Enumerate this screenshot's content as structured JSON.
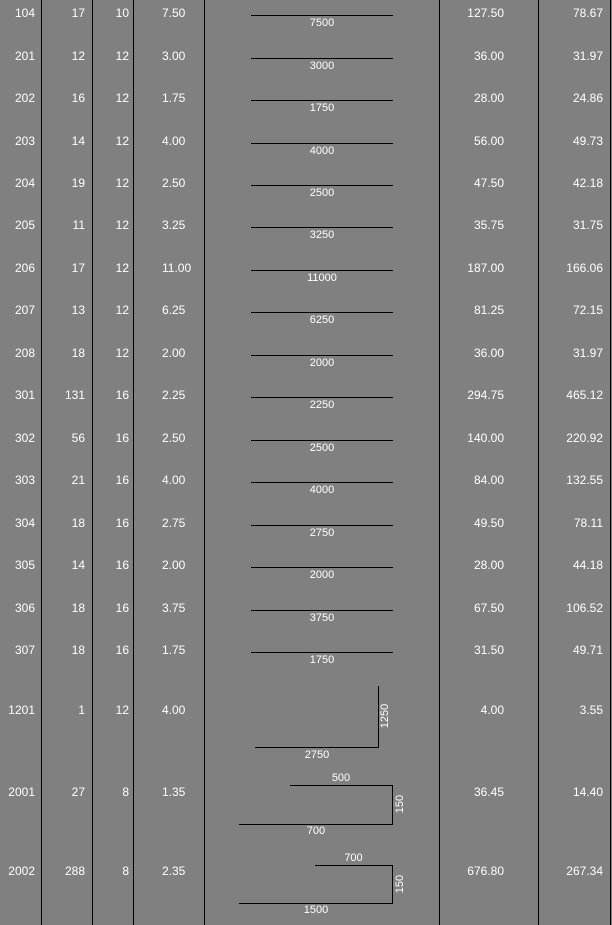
{
  "rows": [
    {
      "mark": "104",
      "count": "17",
      "dia": "10",
      "length": "7.50",
      "shape": "straight",
      "dims": [
        "7500"
      ],
      "total": "127.50",
      "weight": "78.67"
    },
    {
      "mark": "201",
      "count": "12",
      "dia": "12",
      "length": "3.00",
      "shape": "straight",
      "dims": [
        "3000"
      ],
      "total": "36.00",
      "weight": "31.97"
    },
    {
      "mark": "202",
      "count": "16",
      "dia": "12",
      "length": "1.75",
      "shape": "straight",
      "dims": [
        "1750"
      ],
      "total": "28.00",
      "weight": "24.86"
    },
    {
      "mark": "203",
      "count": "14",
      "dia": "12",
      "length": "4.00",
      "shape": "straight",
      "dims": [
        "4000"
      ],
      "total": "56.00",
      "weight": "49.73"
    },
    {
      "mark": "204",
      "count": "19",
      "dia": "12",
      "length": "2.50",
      "shape": "straight",
      "dims": [
        "2500"
      ],
      "total": "47.50",
      "weight": "42.18"
    },
    {
      "mark": "205",
      "count": "11",
      "dia": "12",
      "length": "3.25",
      "shape": "straight",
      "dims": [
        "3250"
      ],
      "total": "35.75",
      "weight": "31.75"
    },
    {
      "mark": "206",
      "count": "17",
      "dia": "12",
      "length": "11.00",
      "shape": "straight",
      "dims": [
        "11000"
      ],
      "total": "187.00",
      "weight": "166.06"
    },
    {
      "mark": "207",
      "count": "13",
      "dia": "12",
      "length": "6.25",
      "shape": "straight",
      "dims": [
        "6250"
      ],
      "total": "81.25",
      "weight": "72.15"
    },
    {
      "mark": "208",
      "count": "18",
      "dia": "12",
      "length": "2.00",
      "shape": "straight",
      "dims": [
        "2000"
      ],
      "total": "36.00",
      "weight": "31.97"
    },
    {
      "mark": "301",
      "count": "131",
      "dia": "16",
      "length": "2.25",
      "shape": "straight",
      "dims": [
        "2250"
      ],
      "total": "294.75",
      "weight": "465.12"
    },
    {
      "mark": "302",
      "count": "56",
      "dia": "16",
      "length": "2.50",
      "shape": "straight",
      "dims": [
        "2500"
      ],
      "total": "140.00",
      "weight": "220.92"
    },
    {
      "mark": "303",
      "count": "21",
      "dia": "16",
      "length": "4.00",
      "shape": "straight",
      "dims": [
        "4000"
      ],
      "total": "84.00",
      "weight": "132.55"
    },
    {
      "mark": "304",
      "count": "18",
      "dia": "16",
      "length": "2.75",
      "shape": "straight",
      "dims": [
        "2750"
      ],
      "total": "49.50",
      "weight": "78.11"
    },
    {
      "mark": "305",
      "count": "14",
      "dia": "16",
      "length": "2.00",
      "shape": "straight",
      "dims": [
        "2000"
      ],
      "total": "28.00",
      "weight": "44.18"
    },
    {
      "mark": "306",
      "count": "18",
      "dia": "16",
      "length": "3.75",
      "shape": "straight",
      "dims": [
        "3750"
      ],
      "total": "67.50",
      "weight": "106.52"
    },
    {
      "mark": "307",
      "count": "18",
      "dia": "16",
      "length": "1.75",
      "shape": "straight",
      "dims": [
        "1750"
      ],
      "total": "31.50",
      "weight": "49.71"
    },
    {
      "mark": "1201",
      "count": "1",
      "dia": "12",
      "length": "4.00",
      "shape": "L-bend",
      "dims": [
        "1250",
        "2750"
      ],
      "total": "4.00",
      "weight": "3.55"
    },
    {
      "mark": "2001",
      "count": "27",
      "dia": "8",
      "length": "1.35",
      "shape": "hook",
      "dims": [
        "500",
        "150",
        "700"
      ],
      "total": "36.45",
      "weight": "14.40"
    },
    {
      "mark": "2002",
      "count": "288",
      "dia": "8",
      "length": "2.35",
      "shape": "hook",
      "dims": [
        "700",
        "150",
        "1500"
      ],
      "total": "676.80",
      "weight": "267.34"
    }
  ]
}
